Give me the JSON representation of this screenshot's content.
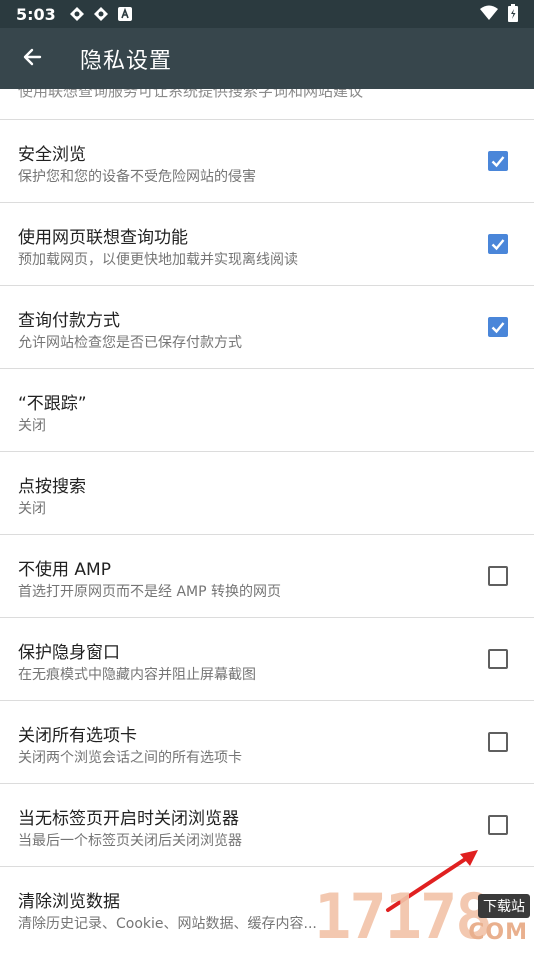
{
  "status_bar": {
    "time": "5:03",
    "icons": [
      "bubble-icon",
      "bubble-icon",
      "a-square-icon"
    ],
    "right_icons": [
      "wifi-icon",
      "battery-icon"
    ]
  },
  "toolbar": {
    "title": "隐私设置",
    "back_icon": "arrow-left-icon"
  },
  "partial_row_text": "使用联想查询服务可让系统提供搜索字词和网站建议",
  "settings": [
    {
      "title": "安全浏览",
      "subtitle": "保护您和您的设备不受危险网站的侵害",
      "checked": true
    },
    {
      "title": "使用网页联想查询功能",
      "subtitle": "预加载网页，以便更快地加载并实现离线阅读",
      "checked": true
    },
    {
      "title": "查询付款方式",
      "subtitle": "允许网站检查您是否已保存付款方式",
      "checked": true
    },
    {
      "title": "“不跟踪”",
      "subtitle": "关闭",
      "checked": null
    },
    {
      "title": "点按搜索",
      "subtitle": "关闭",
      "checked": null
    },
    {
      "title": "不使用 AMP",
      "subtitle": "首选打开原网页而不是经 AMP 转换的网页",
      "checked": false
    },
    {
      "title": "保护隐身窗口",
      "subtitle": "在无痕模式中隐藏内容并阻止屏幕截图",
      "checked": false
    },
    {
      "title": "关闭所有选项卡",
      "subtitle": "关闭两个浏览会话之间的所有选项卡",
      "checked": false
    },
    {
      "title": "当无标签页开启时关闭浏览器",
      "subtitle": "当最后一个标签页关闭后关闭浏览器",
      "checked": false
    },
    {
      "title": "清除浏览数据",
      "subtitle": "清除历史记录、Cookie、网站数据、缓存内容...",
      "checked": null
    }
  ],
  "watermark": {
    "text": "17178",
    "badge": "下载站",
    "domain": "COM"
  },
  "colors": {
    "status_bar": "#2b3a3f",
    "toolbar": "#37464c",
    "checkbox_checked": "#4a86d9",
    "annotation_arrow": "#e02020"
  }
}
